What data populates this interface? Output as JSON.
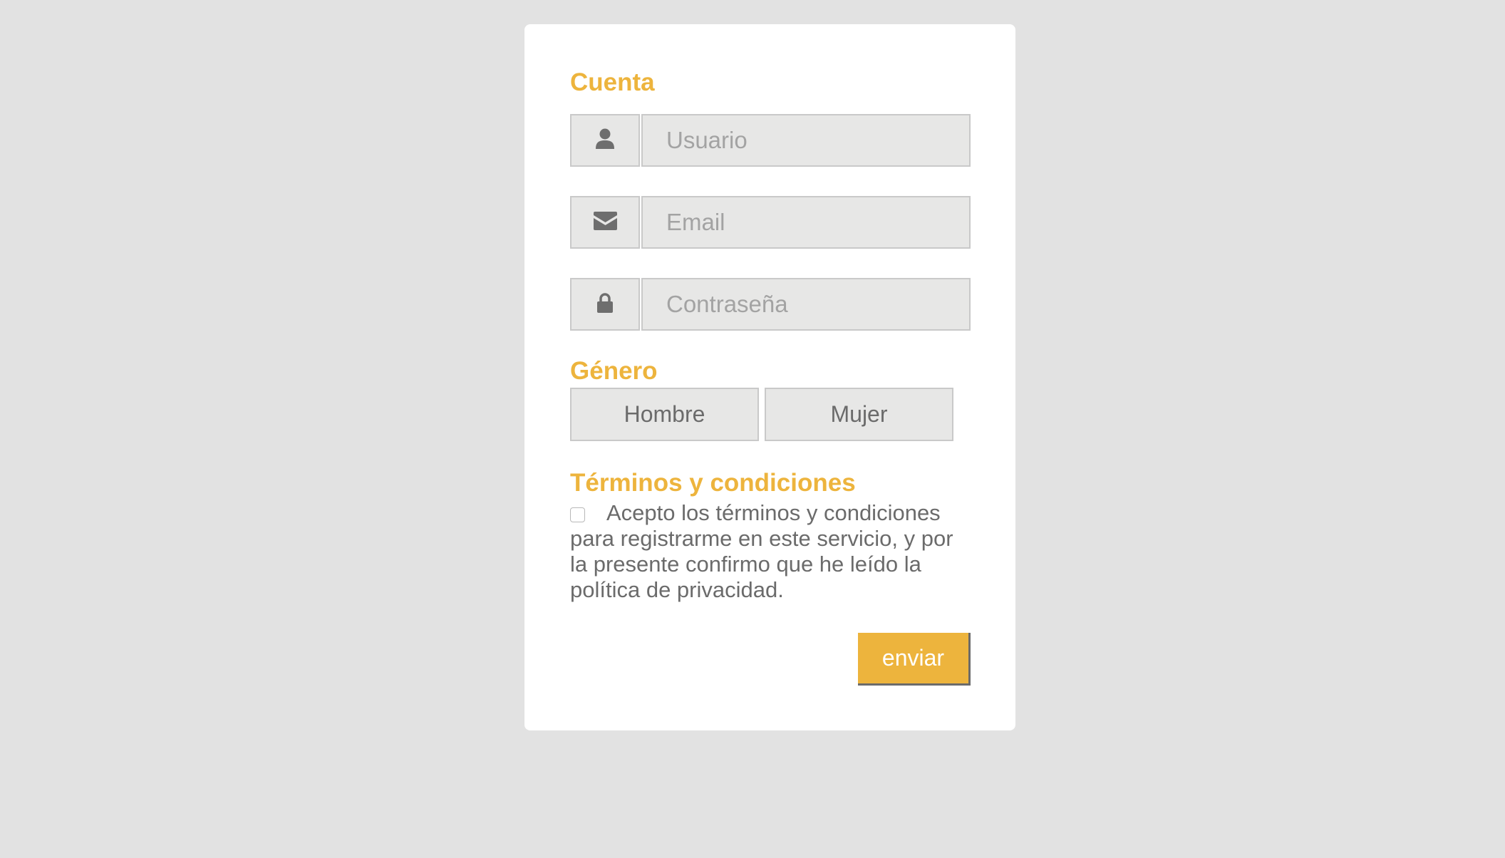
{
  "sections": {
    "account_title": "Cuenta",
    "gender_title": "Género",
    "terms_title": "Términos y condiciones"
  },
  "fields": {
    "username": {
      "placeholder": "Usuario",
      "value": "",
      "icon": "user-icon"
    },
    "email": {
      "placeholder": "Email",
      "value": "",
      "icon": "envelope-icon"
    },
    "password": {
      "placeholder": "Contraseña",
      "value": "",
      "icon": "lock-icon"
    }
  },
  "gender": {
    "options": [
      "Hombre",
      "Mujer"
    ]
  },
  "terms": {
    "text": "Acepto los términos y condiciones para registrarme en este servicio, y por la presente confirmo que he leído la política de privacidad.",
    "checked": false
  },
  "submit_label": "enviar",
  "colors": {
    "accent": "#edb43d",
    "background": "#e2e2e2",
    "card": "#ffffff",
    "field_bg": "#e7e7e6",
    "field_border": "#c9c9c9",
    "text": "#6b6b6b",
    "placeholder": "#a3a3a3"
  }
}
